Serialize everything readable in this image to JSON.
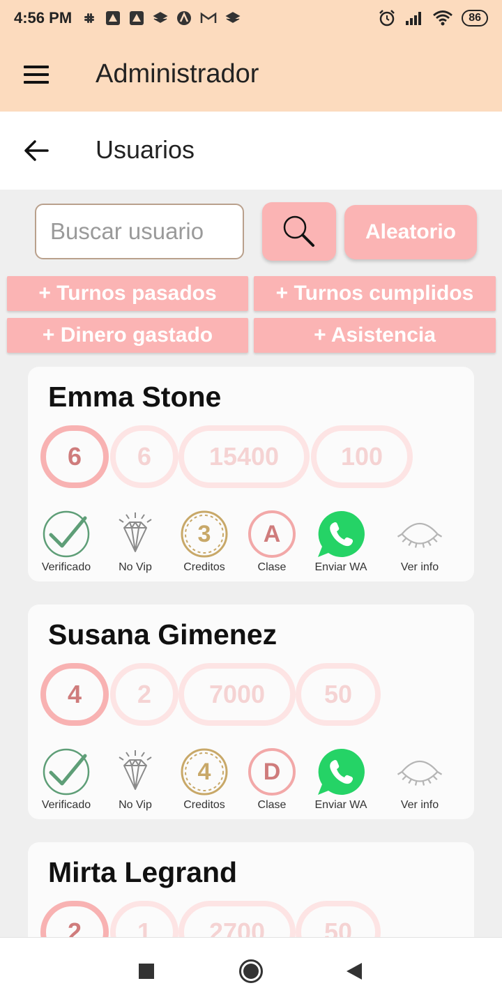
{
  "status_bar": {
    "time": "4:56 PM",
    "battery": "86",
    "notification_icons": [
      "slack-icon",
      "app-icon",
      "app-icon",
      "stack-icon",
      "arch-icon",
      "gmail-icon",
      "stack-icon"
    ],
    "right_icons": [
      "alarm-icon",
      "signal-icon",
      "wifi-icon"
    ]
  },
  "app_bar": {
    "title": "Administrador"
  },
  "sub_bar": {
    "title": "Usuarios"
  },
  "search": {
    "placeholder": "Buscar usuario",
    "value": "",
    "random_label": "Aleatorio"
  },
  "filters": {
    "turnos_pasados": "+ Turnos pasados",
    "turnos_cumplidos": "+ Turnos cumplidos",
    "dinero_gastado": "+ Dinero gastado",
    "asistencia": "+ Asistencia"
  },
  "users": [
    {
      "name": "Emma Stone",
      "stats": [
        "6",
        "6",
        "15400",
        "100"
      ],
      "verified_label": "Verificado",
      "vip_label": "No Vip",
      "credits_value": "3",
      "credits_label": "Creditos",
      "class_value": "A",
      "class_label": "Clase",
      "whatsapp_label": "Enviar WA",
      "info_label": "Ver info"
    },
    {
      "name": "Susana Gimenez",
      "stats": [
        "4",
        "2",
        "7000",
        "50"
      ],
      "verified_label": "Verificado",
      "vip_label": "No Vip",
      "credits_value": "4",
      "credits_label": "Creditos",
      "class_value": "D",
      "class_label": "Clase",
      "whatsapp_label": "Enviar WA",
      "info_label": "Ver info"
    },
    {
      "name": "Mirta Legrand",
      "stats": [
        "2",
        "1",
        "2700",
        "50"
      ]
    }
  ],
  "colors": {
    "header_bg": "#fcdbbe",
    "accent_pink": "#fbb4b4",
    "verified_green": "#5e9e77",
    "credits_gold": "#c8a868",
    "whatsapp_green": "#25d366"
  }
}
